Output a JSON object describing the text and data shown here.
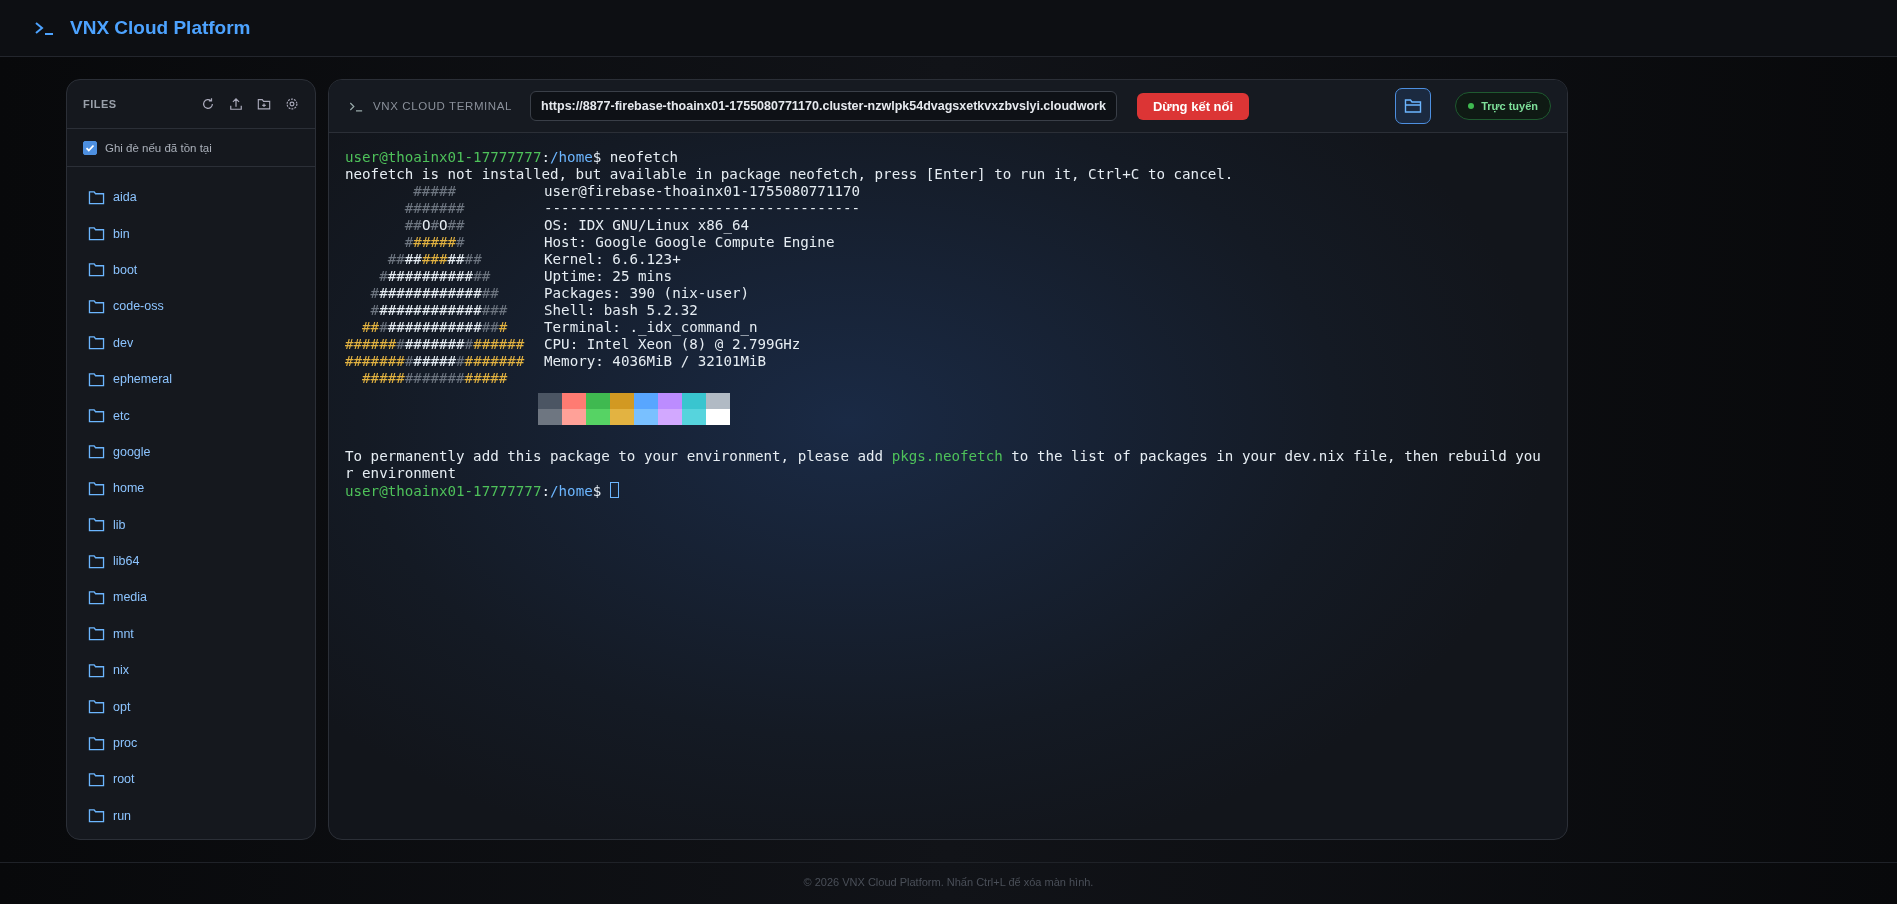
{
  "app": {
    "title": "VNX Cloud Platform"
  },
  "files": {
    "title": "FILES",
    "overwrite": {
      "label": "Ghi đè nếu đã tồn tại",
      "checked": true
    },
    "items": [
      "aida",
      "bin",
      "boot",
      "code-oss",
      "dev",
      "ephemeral",
      "etc",
      "google",
      "home",
      "lib",
      "lib64",
      "media",
      "mnt",
      "nix",
      "opt",
      "proc",
      "root",
      "run"
    ]
  },
  "terminal": {
    "title": "VNX CLOUD TERMINAL",
    "url": "https://8877-firebase-thoainx01-1755080771170.cluster-nzwlpk54dvagsxetkvxzbvslyi.cloudwork",
    "disconnect": "Dừng kết nối",
    "status": {
      "label": "Trực tuyến",
      "online": true
    },
    "lines": [
      {
        "kind": "text",
        "segments": [
          {
            "text": "user@thoainx01-17777777",
            "color": "#4ec15a"
          },
          {
            "text": ":",
            "color": "#e6edf3"
          },
          {
            "text": "/home",
            "color": "#6cb6ff"
          },
          {
            "text": "$ neofetch",
            "color": "#e6edf3"
          }
        ]
      },
      {
        "kind": "text",
        "segments": [
          {
            "text": "neofetch is not installed, but available in package neofetch, press [Enter] to run it, Ctrl+C to cancel.",
            "color": "#e6edf3"
          }
        ]
      },
      {
        "kind": "split",
        "info": "user@firebase-thoainx01-1755080771170",
        "art": [
          {
            "text": "        #####",
            "color": "#6e7681"
          }
        ]
      },
      {
        "kind": "split",
        "info": "-------------------------------------",
        "art": [
          {
            "text": "       #######",
            "color": "#6e7681"
          }
        ]
      },
      {
        "kind": "split",
        "info": "OS: IDX GNU/Linux x86_64",
        "art": [
          {
            "text": "       ##",
            "color": "#6e7681"
          },
          {
            "text": "O",
            "color": "#e6edf3"
          },
          {
            "text": "#",
            "color": "#6e7681"
          },
          {
            "text": "O",
            "color": "#e6edf3"
          },
          {
            "text": "##",
            "color": "#6e7681"
          }
        ]
      },
      {
        "kind": "split",
        "info": "Host: Google Google Compute Engine",
        "art": [
          {
            "text": "       #",
            "color": "#6e7681"
          },
          {
            "text": "#####",
            "color": "#e3b341"
          },
          {
            "text": "#",
            "color": "#6e7681"
          }
        ]
      },
      {
        "kind": "split",
        "info": "Kernel: 6.6.123+",
        "art": [
          {
            "text": "     ##",
            "color": "#6e7681"
          },
          {
            "text": "##",
            "color": "#e6edf3"
          },
          {
            "text": "###",
            "color": "#e3b341"
          },
          {
            "text": "##",
            "color": "#e6edf3"
          },
          {
            "text": "##",
            "color": "#6e7681"
          }
        ]
      },
      {
        "kind": "split",
        "info": "Uptime: 25 mins",
        "art": [
          {
            "text": "    #",
            "color": "#6e7681"
          },
          {
            "text": "##########",
            "color": "#e6edf3"
          },
          {
            "text": "##",
            "color": "#6e7681"
          }
        ]
      },
      {
        "kind": "split",
        "info": "Packages: 390 (nix-user)",
        "art": [
          {
            "text": "   #",
            "color": "#6e7681"
          },
          {
            "text": "############",
            "color": "#e6edf3"
          },
          {
            "text": "##",
            "color": "#6e7681"
          }
        ]
      },
      {
        "kind": "split",
        "info": "Shell: bash 5.2.32",
        "art": [
          {
            "text": "   #",
            "color": "#6e7681"
          },
          {
            "text": "############",
            "color": "#e6edf3"
          },
          {
            "text": "###",
            "color": "#6e7681"
          }
        ]
      },
      {
        "kind": "split",
        "info": "Terminal: ._idx_command_n",
        "art": [
          {
            "text": "  ##",
            "color": "#e3b341"
          },
          {
            "text": "#",
            "color": "#6e7681"
          },
          {
            "text": "###########",
            "color": "#e6edf3"
          },
          {
            "text": "##",
            "color": "#6e7681"
          },
          {
            "text": "#",
            "color": "#e3b341"
          }
        ]
      },
      {
        "kind": "split",
        "info": "CPU: Intel Xeon (8) @ 2.799GHz",
        "art": [
          {
            "text": "######",
            "color": "#e3b341"
          },
          {
            "text": "#",
            "color": "#6e7681"
          },
          {
            "text": "#######",
            "color": "#e6edf3"
          },
          {
            "text": "#",
            "color": "#6e7681"
          },
          {
            "text": "######",
            "color": "#e3b341"
          }
        ]
      },
      {
        "kind": "split",
        "info": "Memory: 4036MiB / 32101MiB",
        "art": [
          {
            "text": "#######",
            "color": "#e3b341"
          },
          {
            "text": "#",
            "color": "#6e7681"
          },
          {
            "text": "#####",
            "color": "#e6edf3"
          },
          {
            "text": "#",
            "color": "#6e7681"
          },
          {
            "text": "#######",
            "color": "#e3b341"
          }
        ]
      },
      {
        "kind": "split",
        "art": [
          {
            "text": "  #####",
            "color": "#e3b341"
          },
          {
            "text": "#######",
            "color": "#6e7681"
          },
          {
            "text": "#####",
            "color": "#e3b341"
          }
        ]
      },
      {
        "kind": "palette",
        "rows": [
          [
            {
              "color": "#4b5563"
            },
            {
              "color": "#ff7b72"
            },
            {
              "color": "#3fb950"
            },
            {
              "color": "#d29922"
            },
            {
              "color": "#58a6ff"
            },
            {
              "color": "#bc8cff"
            },
            {
              "color": "#39c5cf"
            },
            {
              "color": "#b1bac4"
            }
          ],
          [
            {
              "color": "#6e7681"
            },
            {
              "color": "#ffa198"
            },
            {
              "color": "#56d364"
            },
            {
              "color": "#e3b341"
            },
            {
              "color": "#79c0ff"
            },
            {
              "color": "#d2a8ff"
            },
            {
              "color": "#56d4dd"
            },
            {
              "color": "#ffffff"
            }
          ]
        ]
      },
      {
        "kind": "blank"
      },
      {
        "kind": "text",
        "segments": [
          {
            "text": "To permanently add this package to your environment, please add ",
            "color": "#e6edf3"
          },
          {
            "text": "pkgs.neofetch",
            "color": "#4ec15a"
          },
          {
            "text": " to the list of packages in your dev.nix file, then rebuild you",
            "color": "#e6edf3"
          }
        ]
      },
      {
        "kind": "text",
        "segments": [
          {
            "text": "r environment",
            "color": "#e6edf3"
          }
        ]
      },
      {
        "kind": "text",
        "cursor": true,
        "segments": [
          {
            "text": "user@thoainx01-17777777",
            "color": "#4ec15a"
          },
          {
            "text": ":",
            "color": "#e6edf3"
          },
          {
            "text": "/home",
            "color": "#6cb6ff"
          },
          {
            "text": "$ ",
            "color": "#e6edf3"
          }
        ]
      }
    ]
  },
  "footer": "© 2026 VNX Cloud Platform. Nhấn Ctrl+L để xóa màn hình."
}
